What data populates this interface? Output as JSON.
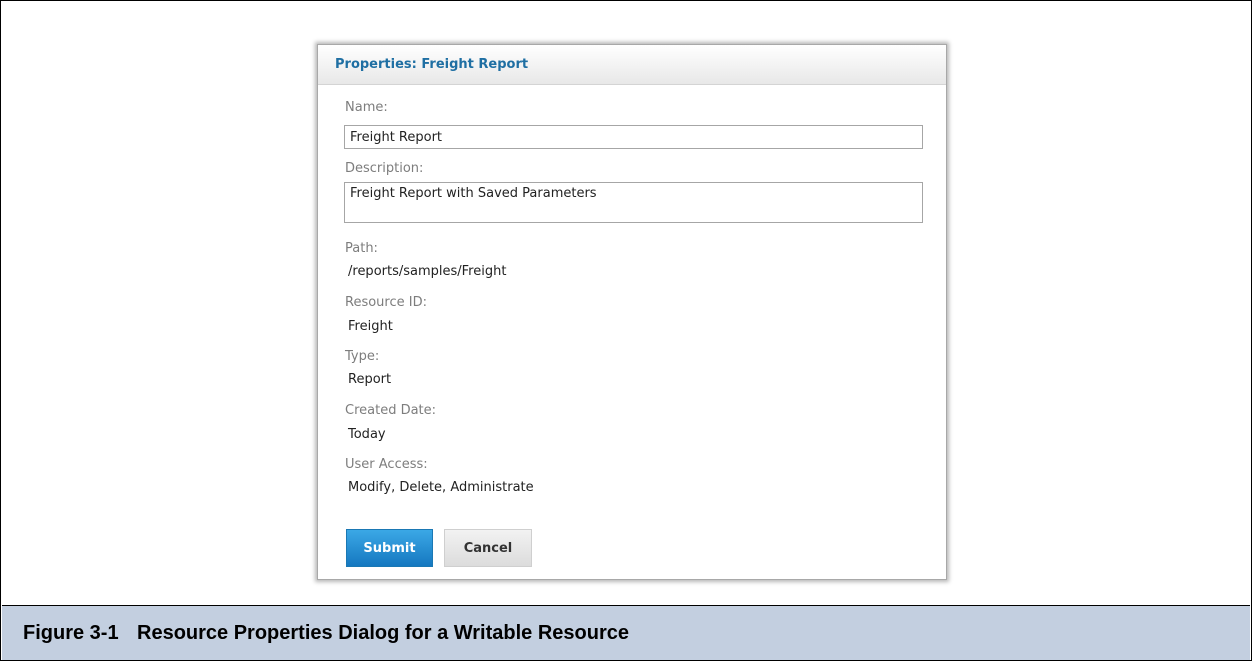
{
  "dialog": {
    "title": "Properties: Freight Report",
    "name_label": "Name:",
    "name_value": "Freight Report",
    "description_label": "Description:",
    "description_value": "Freight Report with Saved Parameters",
    "path_label": "Path:",
    "path_value": "/reports/samples/Freight",
    "resource_id_label": "Resource ID:",
    "resource_id_value": "Freight",
    "type_label": "Type:",
    "type_value": "Report",
    "created_date_label": "Created Date:",
    "created_date_value": "Today",
    "user_access_label": "User Access:",
    "user_access_value": "Modify, Delete, Administrate",
    "submit_label": "Submit",
    "cancel_label": "Cancel"
  },
  "caption": {
    "number": "Figure 3-1",
    "title": "Resource Properties Dialog for a Writable Resource"
  },
  "colors": {
    "dialog_title": "#1f6fa3",
    "submit_button": "#1578c0",
    "caption_background": "#c3cfe0"
  }
}
